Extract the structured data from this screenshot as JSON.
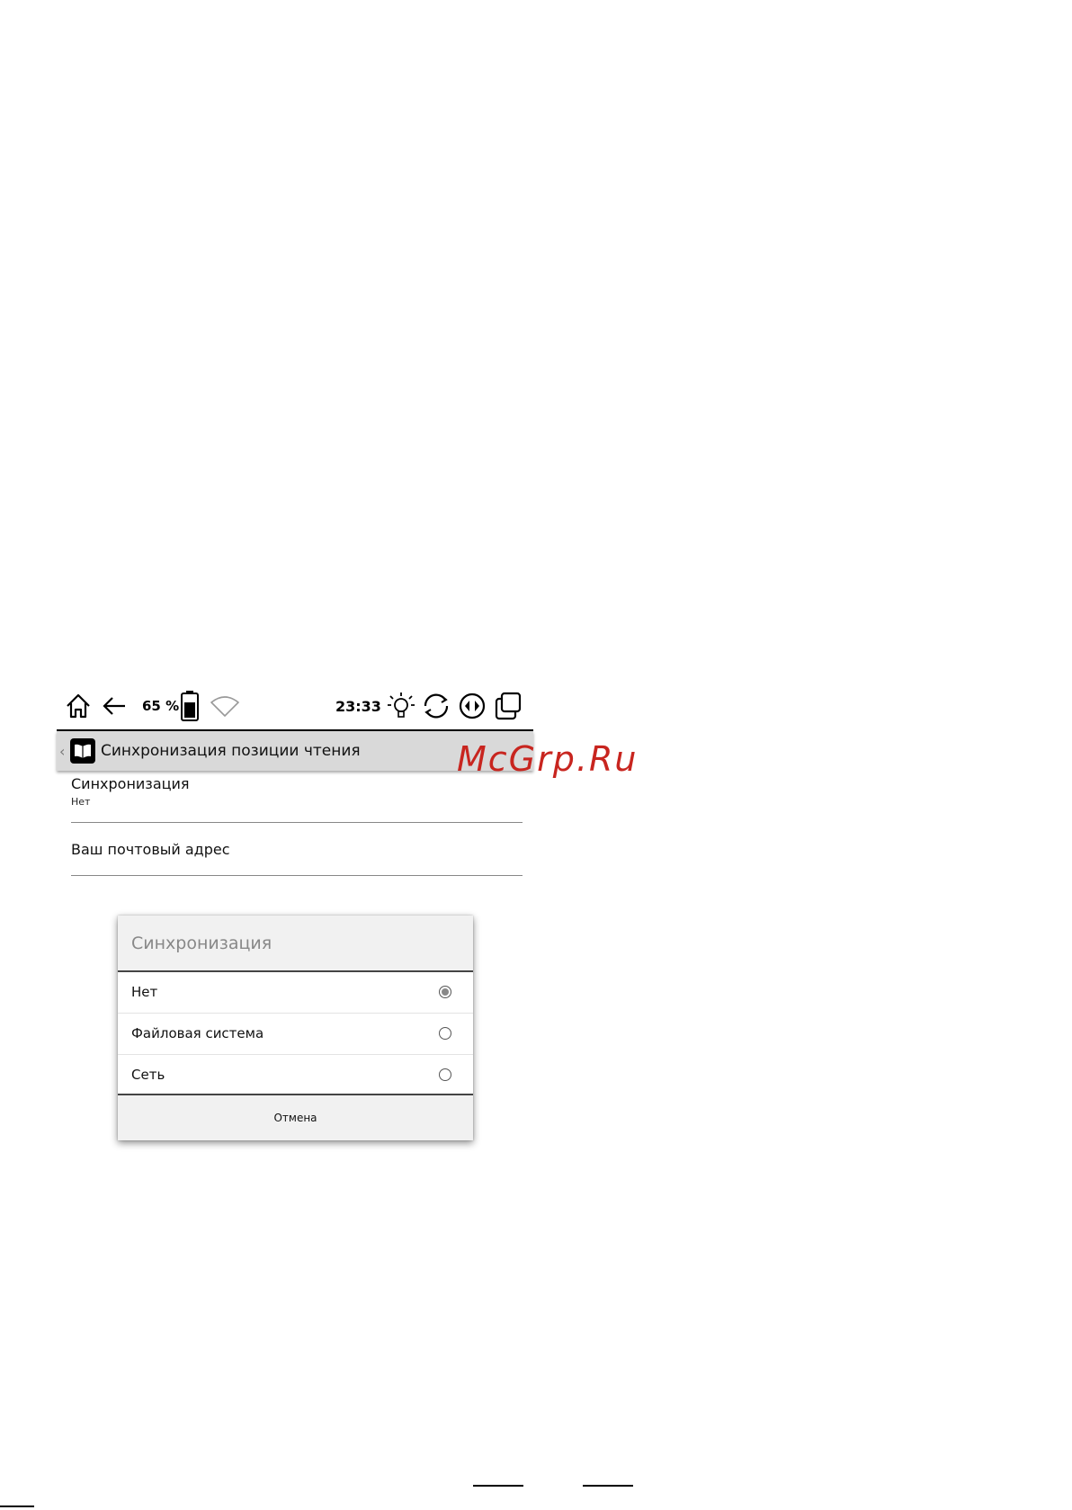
{
  "status_bar": {
    "battery_percent": "65 %",
    "battery_level": 0.65,
    "time": "23:33",
    "icons": [
      "home-icon",
      "back-arrow-icon",
      "battery-icon",
      "wifi-icon",
      "frontlight-icon",
      "sync-icon",
      "page-turn-icon",
      "task-manager-icon"
    ]
  },
  "app_header": {
    "title": "Синхронизация позиции чтения",
    "icon": "book-icon"
  },
  "settings": [
    {
      "title": "Синхронизация",
      "value": "Нет"
    },
    {
      "title": "Ваш почтовый адрес"
    }
  ],
  "watermark": "McGrp.Ru",
  "dialog": {
    "title": "Синхронизация",
    "options": [
      {
        "label": "Нет",
        "selected": true
      },
      {
        "label": "Файловая система",
        "selected": false
      },
      {
        "label": "Сеть",
        "selected": false
      }
    ],
    "cancel_label": "Отмена"
  },
  "colors": {
    "title_bar_bg": "#d9d9d9",
    "dialog_header_bg": "#f1f1f1",
    "watermark": "#c8251f"
  }
}
